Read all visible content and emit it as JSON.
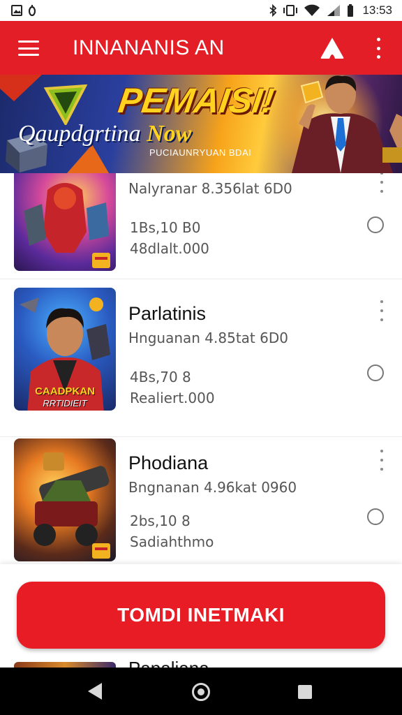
{
  "status_bar": {
    "time": "13:53",
    "left_icons": [
      "image-icon",
      "notification-icon"
    ],
    "right_icons": [
      "bluetooth-icon",
      "vibrate-icon",
      "wifi-icon",
      "signal-icon",
      "battery-icon"
    ]
  },
  "app_bar": {
    "title": "INNANANIS AN",
    "icons": [
      "menu-icon",
      "alert-icon",
      "more-vertical-icon"
    ],
    "color": "#e41e26"
  },
  "banner": {
    "title": "PEMAISI!",
    "subtitle_part1": "Qaupdgrtina",
    "subtitle_part2": "Now",
    "caption": "PUCIAUNRYUAN BDAI"
  },
  "list": {
    "items": [
      {
        "title": "",
        "subtitle": "Nalyranar 8.356lat 6D0",
        "meta1": "1Bs,10 B0",
        "meta2": "48dlalt.000",
        "thumb_icon": "robot-warriors-thumbnail"
      },
      {
        "title": "Parlatinis",
        "subtitle": "Hnguanan 4.85tat 6D0",
        "meta1": "4Bs,70 8",
        "meta2": "Realiert.000",
        "thumb_text_1": "CAADPKAN",
        "thumb_text_2": "RRTIDIEIT",
        "thumb_icon": "hero-portrait-thumbnail"
      },
      {
        "title": "Phodiana",
        "subtitle": "Bngnanan 4.96kat 0960",
        "meta1": "2bs,10 8",
        "meta2": "Sadiahthmo",
        "thumb_icon": "cannon-vehicle-thumbnail"
      }
    ],
    "peek_title": "Papaliana"
  },
  "cta": {
    "label": "TOMDI INETMAKI",
    "color": "#e71c25"
  },
  "nav_bar": {
    "icons": [
      "back-icon",
      "home-icon",
      "recents-icon"
    ]
  }
}
